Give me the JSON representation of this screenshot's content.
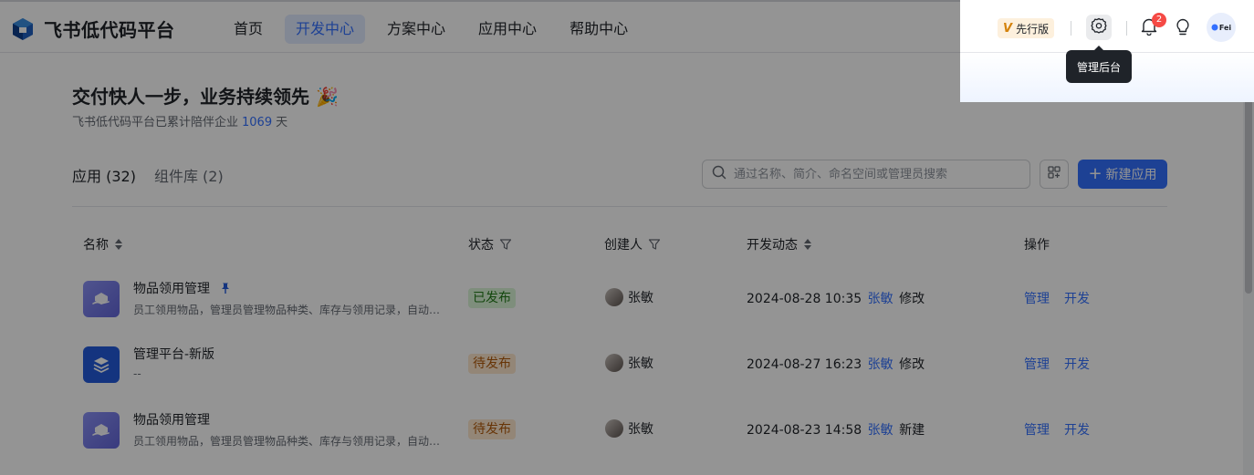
{
  "header": {
    "brand": "飞书低代码平台",
    "nav": [
      {
        "label": "首页",
        "active": false
      },
      {
        "label": "开发中心",
        "active": true
      },
      {
        "label": "方案中心",
        "active": false
      },
      {
        "label": "应用中心",
        "active": false
      },
      {
        "label": "帮助中心",
        "active": false
      }
    ],
    "preview_badge": "先行版",
    "preview_badge_mark": "V",
    "notification_count": "2",
    "avatar_text": "Fei",
    "settings_tooltip": "管理后台"
  },
  "hero": {
    "title": "交付快人一步，业务持续领先 🎉",
    "sub_prefix": "飞书低代码平台已累计陪伴企业",
    "days": "1069",
    "sub_suffix": "天"
  },
  "tabs": [
    {
      "label": "应用 (32)",
      "active": true
    },
    {
      "label": "组件库 (2)",
      "active": false
    }
  ],
  "search": {
    "placeholder": "通过名称、简介、命名空间或管理员搜索",
    "value": ""
  },
  "new_app_button": "新建应用",
  "table": {
    "columns": [
      "名称",
      "状态",
      "创建人",
      "开发动态",
      "操作"
    ],
    "rows": [
      {
        "name": "物品领用管理",
        "pinned": true,
        "desc": "员工领用物品，管理员管理物品种类、库存与领用记录，自动…",
        "icon": "purple",
        "status": "已发布",
        "status_kind": "published",
        "creator": "张敏",
        "activity_time": "2024-08-28 10:35",
        "activity_user": "张敏",
        "activity_action": "修改",
        "op_manage": "管理",
        "op_dev": "开发"
      },
      {
        "name": "管理平台-新版",
        "pinned": false,
        "desc": "--",
        "icon": "blue",
        "status": "待发布",
        "status_kind": "pending",
        "creator": "张敏",
        "activity_time": "2024-08-27 16:23",
        "activity_user": "张敏",
        "activity_action": "修改",
        "op_manage": "管理",
        "op_dev": "开发"
      },
      {
        "name": "物品领用管理",
        "pinned": false,
        "desc": "员工领用物品，管理员管理物品种类、库存与领用记录，自动…",
        "icon": "purple",
        "status": "待发布",
        "status_kind": "pending",
        "creator": "张敏",
        "activity_time": "2024-08-23 14:58",
        "activity_user": "张敏",
        "activity_action": "新建",
        "op_manage": "管理",
        "op_dev": "开发"
      }
    ]
  },
  "colors": {
    "accent": "#3370ff",
    "published": "#237b19",
    "pending": "#b15a0b",
    "badge_red": "#f54a45"
  }
}
